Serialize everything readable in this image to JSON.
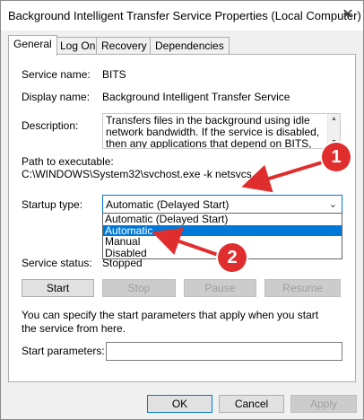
{
  "window": {
    "title": "Background Intelligent Transfer Service Properties (Local Computer)",
    "close_glyph": "✕"
  },
  "tabs": [
    {
      "label": "General",
      "active": true
    },
    {
      "label": "Log On"
    },
    {
      "label": "Recovery"
    },
    {
      "label": "Dependencies"
    }
  ],
  "general": {
    "service_name_label": "Service name:",
    "service_name_value": "BITS",
    "display_name_label": "Display name:",
    "display_name_value": "Background Intelligent Transfer Service",
    "description_label": "Description:",
    "description_value": "Transfers files in the background using idle network bandwidth. If the service is disabled, then any applications that depend on BITS, such as Windows",
    "path_label": "Path to executable:",
    "path_value": "C:\\WINDOWS\\System32\\svchost.exe -k netsvcs -p",
    "startup_type_label": "Startup type:",
    "startup_type_value": "Automatic (Delayed Start)",
    "startup_options": [
      "Automatic (Delayed Start)",
      "Automatic",
      "Manual",
      "Disabled"
    ],
    "highlighted_option": "Automatic",
    "service_status_label": "Service status:",
    "service_status_value": "Stopped",
    "buttons": {
      "start": "Start",
      "stop": "Stop",
      "pause": "Pause",
      "resume": "Resume"
    },
    "start_params_help": "You can specify the start parameters that apply when you start the service from here.",
    "start_params_label": "Start parameters:",
    "start_params_value": ""
  },
  "footer": {
    "ok": "OK",
    "cancel": "Cancel",
    "apply": "Apply"
  },
  "annotations": {
    "badge_1": "1",
    "badge_2": "2",
    "color": "#e02e2e"
  },
  "colors": {
    "accent": "#0078d7",
    "window_bg": "#f0f0f0"
  }
}
